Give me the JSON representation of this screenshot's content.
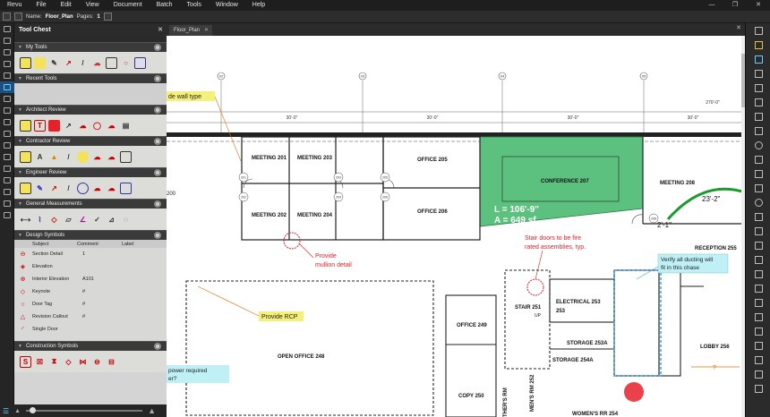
{
  "menu": [
    "Revu",
    "File",
    "Edit",
    "View",
    "Document",
    "Batch",
    "Tools",
    "Window",
    "Help"
  ],
  "window_controls": [
    "—",
    "❐",
    "✕"
  ],
  "docbar": {
    "name_label": "Name:",
    "name_value": "Floor_Plan",
    "pages_label": "Pages:",
    "pages_value": "1"
  },
  "toolchest": {
    "title": "Tool Chest",
    "sections": {
      "my_tools": "My Tools",
      "recent_tools": "Recent Tools",
      "architect_review": "Architect Review",
      "contractor_review": "Contractor Review",
      "engineer_review": "Engineer Review",
      "general_measurements": "General Measurements",
      "design_symbols": "Design Symbols",
      "construction_symbols": "Construction Symbols"
    },
    "design_table": {
      "headers": [
        "Subject",
        "Comment",
        "Label"
      ],
      "rows": [
        {
          "subject": "Section Detail",
          "comment": "1"
        },
        {
          "subject": "Elevation",
          "comment": ""
        },
        {
          "subject": "Interior Elevation",
          "comment": "A101"
        },
        {
          "subject": "Keynote",
          "comment": "#"
        },
        {
          "subject": "Door Tag",
          "comment": "#"
        },
        {
          "subject": "Revision Callout",
          "comment": "#"
        },
        {
          "subject": "Single Door",
          "comment": ""
        }
      ]
    }
  },
  "tab": {
    "label": "Floor_Plan"
  },
  "drawing": {
    "grid_labels": [
      "02",
      "03",
      "04",
      "05"
    ],
    "dims": [
      "30'-0\"",
      "30'-0\"",
      "30'-0\"",
      "30'-0\"",
      "270'-0\""
    ],
    "rooms": {
      "meeting201": "MEETING 201",
      "meeting203": "MEETING 203",
      "meeting202": "MEETING 202",
      "meeting204": "MEETING 204",
      "office205": "OFFICE 205",
      "office206": "OFFICE 206",
      "conference207": "CONFERENCE 207",
      "meeting208": "MEETING 208",
      "reception255": "RECEPTION 255",
      "open_office248": "OPEN OFFICE 248",
      "office249": "OFFICE 249",
      "copy250": "COPY 250",
      "stair251": "STAIR 251",
      "electrical253": "ELECTRICAL 253",
      "storage253a": "STORAGE 253A",
      "storage254a": "STORAGE 254A",
      "lobby256": "LOBBY 256",
      "mens_rm252": "MEN'S RM 252",
      "mothers_rm": "THER'S RM",
      "womens_rr254": "WOMEN'S RR 254"
    },
    "door_tags": [
      "201",
      "202",
      "203",
      "204",
      "205",
      "206",
      "208",
      "253A",
      "254A"
    ],
    "area_measure": {
      "length": "L = 106'-9\"",
      "area": "A = 649 sf"
    },
    "arc_dims": [
      "23'-2\"",
      "2'-1\""
    ],
    "up_label": "UP",
    "dim_question": "?",
    "callouts": {
      "wall_type": "de wall type",
      "provide_rcp": "Provide RCP",
      "mullion_line1": "Provide",
      "mullion_line2": "mullion detail",
      "stair_line1": "Stair doors to be fire",
      "stair_line2": "rated assemblies, typ.",
      "ducting_line1": "Verify all ducting will",
      "ducting_line2": "fit in this chase",
      "power_line1": "power required",
      "power_line2": "er?"
    },
    "left_text": "200"
  },
  "colors": {
    "conference_fill": "#5cc17e",
    "callout_yellow": "#f5f07a",
    "callout_cyan": "#bff0f5",
    "markup_red": "#e8202a",
    "arc_green": "#1b9a2e",
    "chase_blue": "#3ba2e6"
  }
}
